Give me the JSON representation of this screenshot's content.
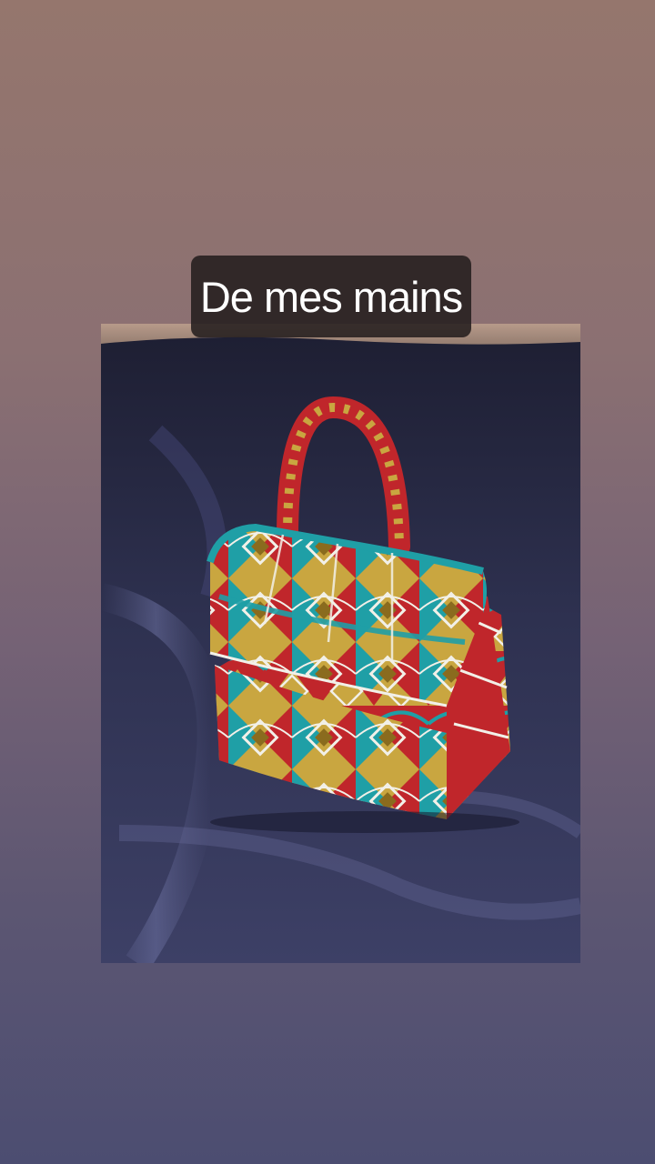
{
  "story": {
    "caption": "De mes mains",
    "background_top": "#95766d",
    "background_bottom": "#4c4d71"
  },
  "photo": {
    "subject-icon": "handbag-icon",
    "cloth_color": "#2e2f48",
    "print_colors": [
      "#1f9fa6",
      "#c9a640",
      "#c0262b",
      "#f2f0e8"
    ]
  }
}
